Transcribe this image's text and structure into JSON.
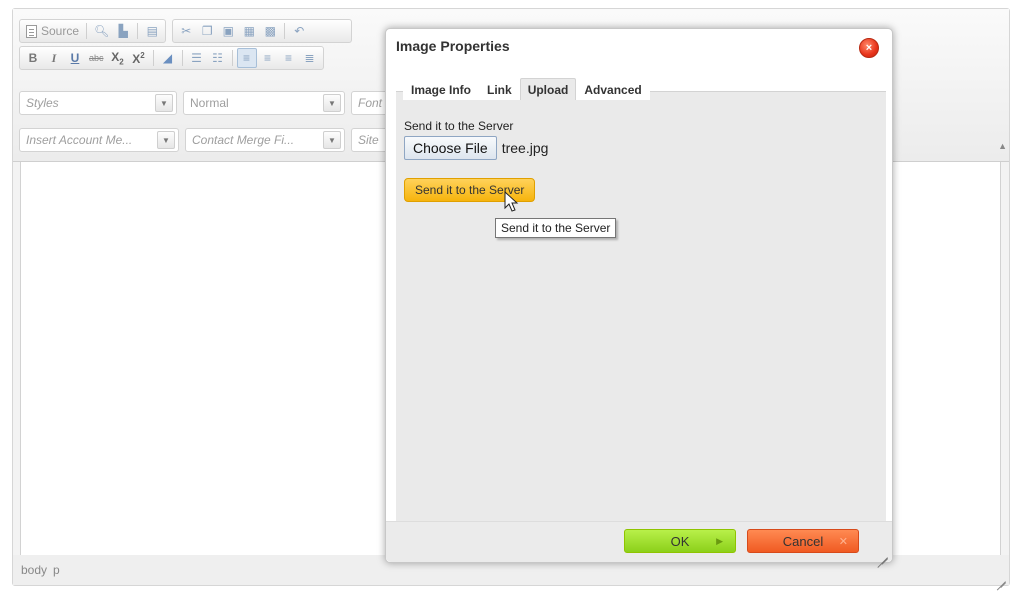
{
  "toolbar": {
    "source_label": "Source",
    "row1_icons": [
      "preview-icon",
      "print-icon",
      "templates-icon",
      "cut-icon",
      "copy-icon",
      "paste-icon",
      "paste-text-icon",
      "paste-word-icon",
      "undo-icon",
      "redo-icon"
    ],
    "row2_icons": [
      "bold-icon",
      "italic-icon",
      "underline-icon",
      "strike-icon",
      "subscript-icon",
      "superscript-icon",
      "remove-format-icon",
      "numbered-list-icon",
      "bulleted-list-icon",
      "align-left-icon",
      "align-center-icon",
      "align-right-icon",
      "justify-icon"
    ],
    "bold": "B",
    "italic": "I",
    "underline": "U",
    "strike": "abc",
    "subscript": "X",
    "superscript": "X"
  },
  "combos": {
    "styles": "Styles",
    "format": "Normal",
    "font": "Font",
    "account_merge": "Insert Account Me...",
    "contact_merge": "Contact Merge Fi...",
    "site": "Site"
  },
  "status_bar": {
    "path": [
      "body",
      "p"
    ]
  },
  "dialog": {
    "title": "Image Properties",
    "close_symbol": "×",
    "tabs": [
      {
        "label": "Image Info",
        "active": false
      },
      {
        "label": "Link",
        "active": false
      },
      {
        "label": "Upload",
        "active": true
      },
      {
        "label": "Advanced",
        "active": false
      }
    ],
    "upload": {
      "field_label": "Send it to the Server",
      "choose_file_label": "Choose File",
      "file_name": "tree.jpg",
      "send_button_label": "Send it to the Server",
      "tooltip": "Send it to the Server"
    },
    "footer": {
      "ok_label": "OK",
      "cancel_label": "Cancel"
    }
  },
  "colors": {
    "ok_button": "#9ad82a",
    "cancel_button": "#f26a2e",
    "send_button": "#f8c02a",
    "close_button": "#e8331a"
  }
}
